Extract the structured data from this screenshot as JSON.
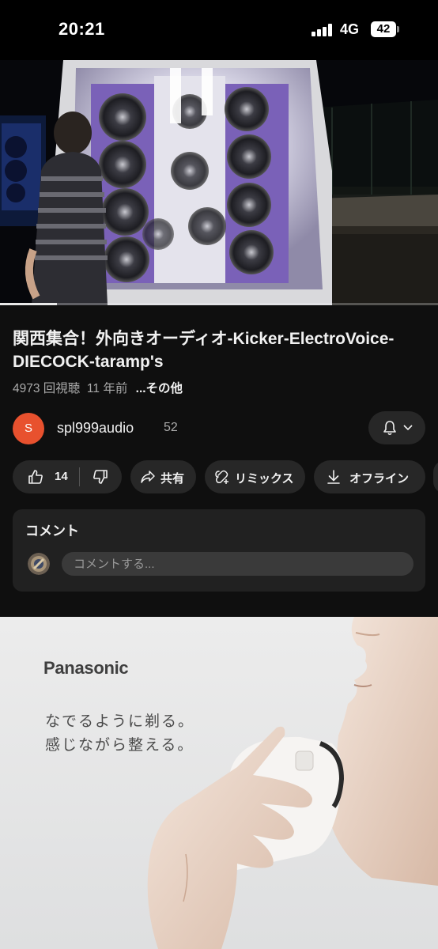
{
  "status_bar": {
    "time": "20:21",
    "network": "4G",
    "battery": "42"
  },
  "video": {
    "title": "関西集合！外向きオーディオ-Kicker-ElectroVoice-DIECOCK-taramp's",
    "views": "4973 回視聴",
    "age": "11 年前",
    "more": "...その他",
    "progress": 0.13
  },
  "channel": {
    "avatar_letter": "S",
    "name": "spl999audio",
    "subscribers": "52",
    "avatar_color": "#e8512e"
  },
  "actions": {
    "likes": "14",
    "share": "共有",
    "remix": "リミックス",
    "offline": "オフライン"
  },
  "comments": {
    "title": "コメント",
    "placeholder": "コメントする..."
  },
  "ad": {
    "brand": "Panasonic",
    "line1": "なでるように剃る。",
    "line2": "感じながら整える。"
  },
  "icons": [
    "signal-icon",
    "battery-icon",
    "bell-icon",
    "chevron-down-icon",
    "thumbs-up-icon",
    "thumbs-down-icon",
    "share-icon",
    "remix-icon",
    "download-icon"
  ],
  "colors": {
    "background": "#0f0f0f",
    "chip": "#272727",
    "card": "#212121",
    "accent": "#e8512e"
  }
}
